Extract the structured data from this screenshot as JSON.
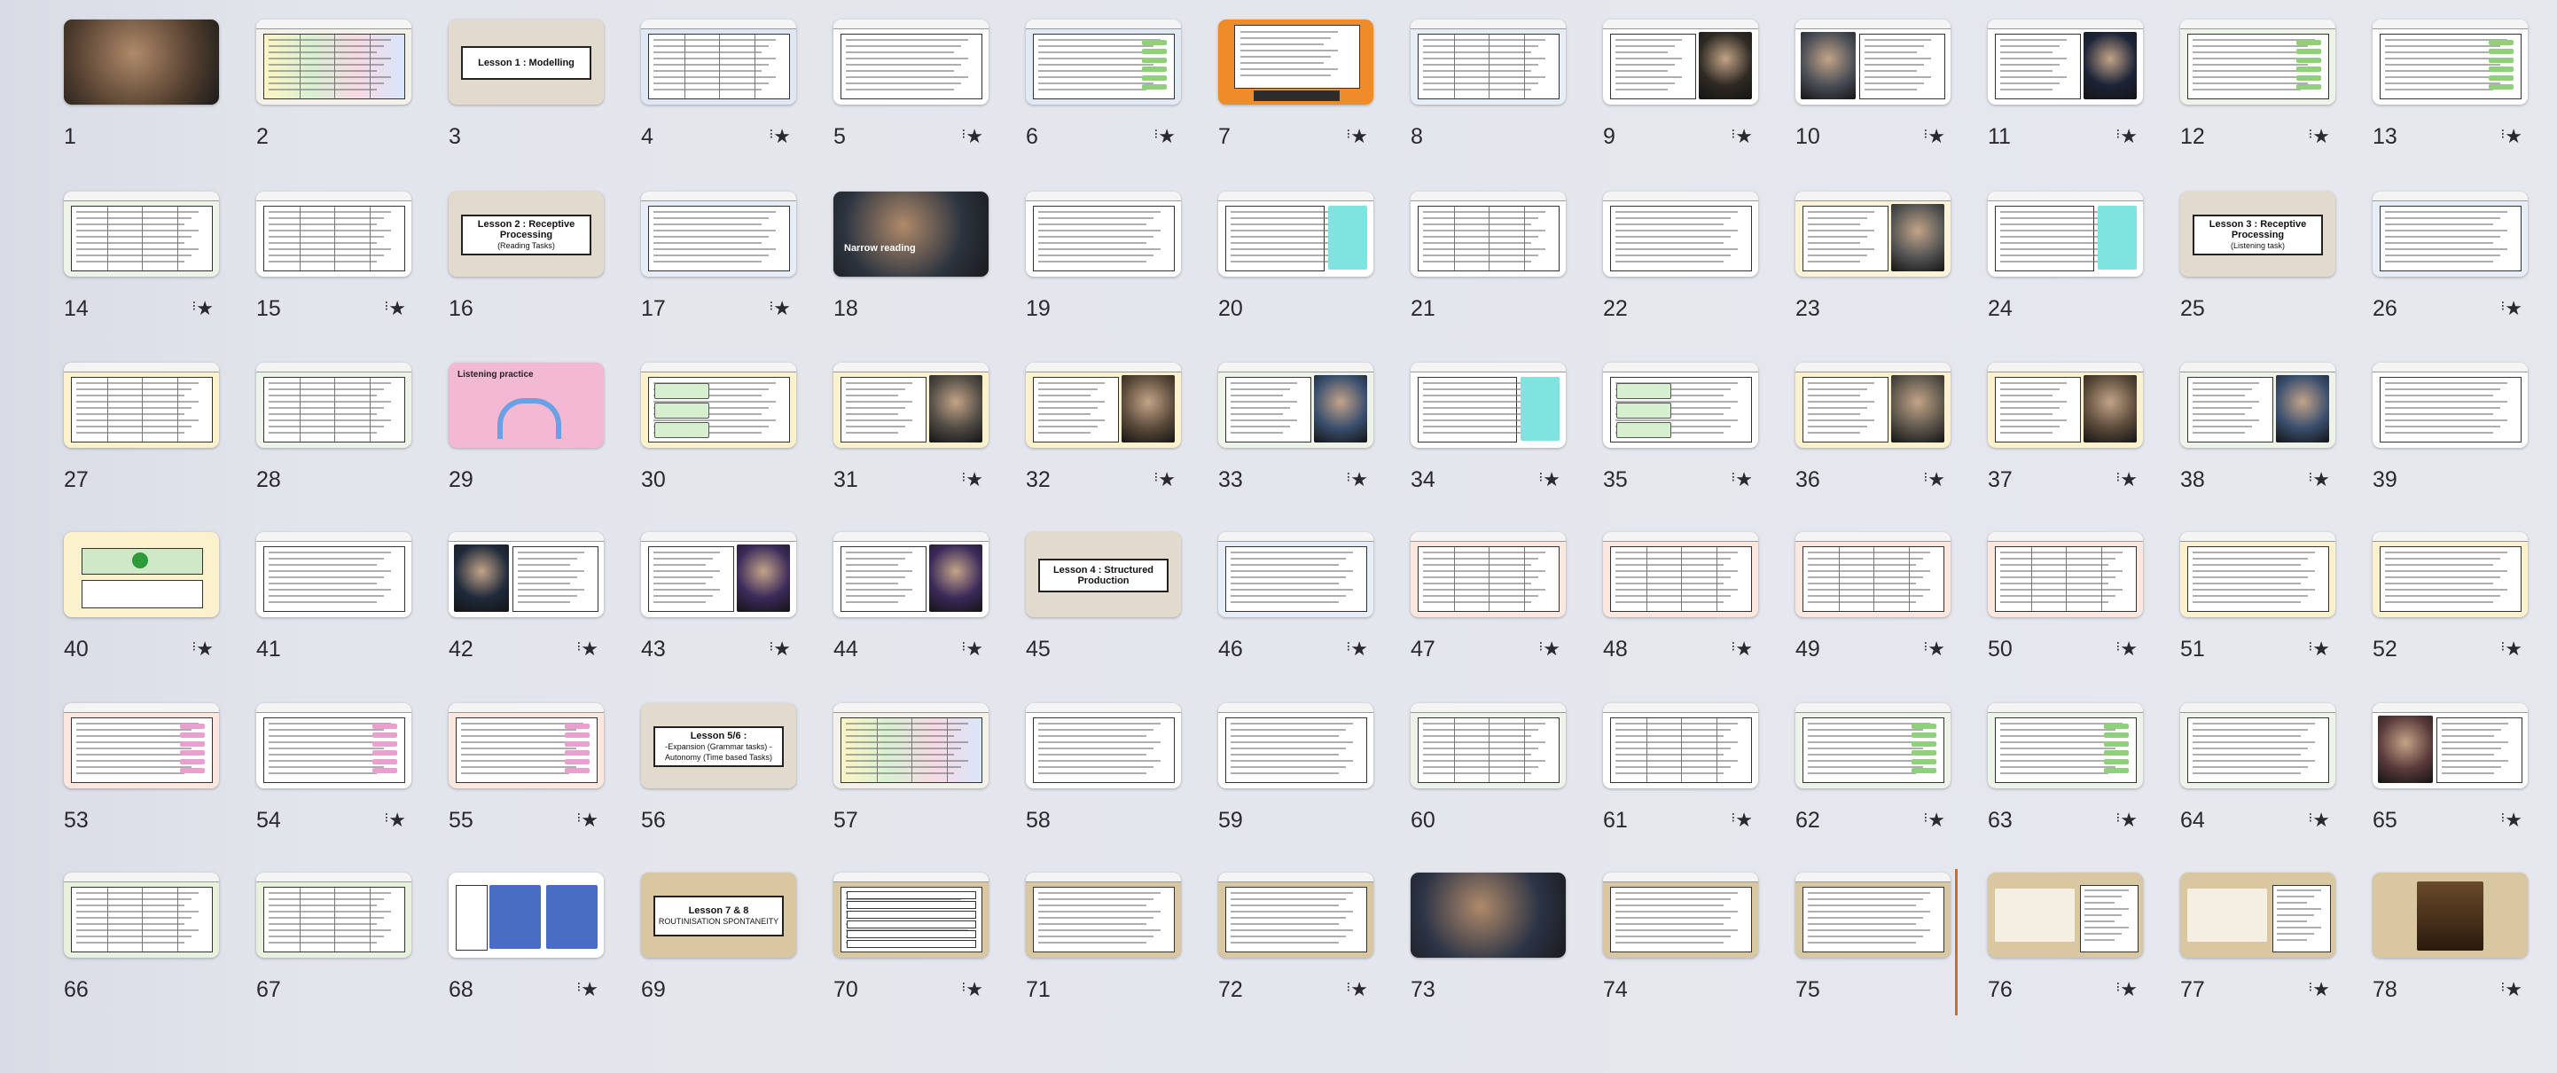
{
  "grid": {
    "slides": [
      {
        "n": "1",
        "starred": false,
        "bg": "#c8b9a6",
        "style": "photo",
        "pic": "#54402f"
      },
      {
        "n": "2",
        "starred": false,
        "bg": "#f3f1e9",
        "style": "table-color"
      },
      {
        "n": "3",
        "starred": false,
        "bg": "#e2dbcd",
        "style": "title",
        "title": "Lesson 1 : Modelling"
      },
      {
        "n": "4",
        "starred": true,
        "bg": "#dfe6f4",
        "style": "list-two"
      },
      {
        "n": "5",
        "starred": true,
        "bg": "#ffffff",
        "style": "list"
      },
      {
        "n": "6",
        "starred": true,
        "bg": "#e1e9f4",
        "style": "list-green"
      },
      {
        "n": "7",
        "starred": true,
        "bg": "#ef8c2a",
        "style": "orange"
      },
      {
        "n": "8",
        "starred": false,
        "bg": "#e6edf6",
        "style": "table"
      },
      {
        "n": "9",
        "starred": true,
        "bg": "#ffffff",
        "style": "list-pic",
        "pic": "#2e2a23"
      },
      {
        "n": "10",
        "starred": true,
        "bg": "#ffffff",
        "style": "pic-list",
        "pic": "#4b4f57"
      },
      {
        "n": "11",
        "starred": true,
        "bg": "#ffffff",
        "style": "list-pic",
        "pic": "#1c2437"
      },
      {
        "n": "12",
        "starred": true,
        "bg": "#eef3ea",
        "style": "list-green"
      },
      {
        "n": "13",
        "starred": true,
        "bg": "#ffffff",
        "style": "list-green"
      },
      {
        "n": "14",
        "starred": true,
        "bg": "#edf3e7",
        "style": "list-two"
      },
      {
        "n": "15",
        "starred": true,
        "bg": "#ffffff",
        "style": "table"
      },
      {
        "n": "16",
        "starred": false,
        "bg": "#e2dbcd",
        "style": "title",
        "title": "Lesson 2 : Receptive Processing",
        "subtitle": "(Reading Tasks)"
      },
      {
        "n": "17",
        "starred": true,
        "bg": "#e6edf6",
        "style": "list"
      },
      {
        "n": "18",
        "starred": false,
        "bg": "#4f8b5a",
        "style": "photo-label",
        "pic": "#2c3440",
        "label": "Narrow reading"
      },
      {
        "n": "19",
        "starred": false,
        "bg": "#ffffff",
        "style": "text"
      },
      {
        "n": "20",
        "starred": false,
        "bg": "#ffffff",
        "style": "text-cyan"
      },
      {
        "n": "21",
        "starred": false,
        "bg": "#ffffff",
        "style": "table"
      },
      {
        "n": "22",
        "starred": false,
        "bg": "#ffffff",
        "style": "text"
      },
      {
        "n": "23",
        "starred": false,
        "bg": "#fbf3d6",
        "style": "text-pic"
      },
      {
        "n": "24",
        "starred": false,
        "bg": "#ffffff",
        "style": "text-cyan"
      },
      {
        "n": "25",
        "starred": false,
        "bg": "#e2dbcd",
        "style": "title",
        "title": "Lesson 3 : Receptive Processing",
        "subtitle": "(Listening task)"
      },
      {
        "n": "26",
        "starred": true,
        "bg": "#e6edf6",
        "style": "list"
      },
      {
        "n": "27",
        "starred": false,
        "bg": "#fbf1cd",
        "style": "table"
      },
      {
        "n": "28",
        "starred": false,
        "bg": "#eef3ea",
        "style": "table"
      },
      {
        "n": "29",
        "starred": false,
        "bg": "#f3b9d3",
        "style": "headphones",
        "label": "Listening practice"
      },
      {
        "n": "30",
        "starred": false,
        "bg": "#fbf1cd",
        "style": "boxes"
      },
      {
        "n": "31",
        "starred": true,
        "bg": "#fbf1cd",
        "style": "list-pic",
        "pic": "#4f4a43"
      },
      {
        "n": "32",
        "starred": true,
        "bg": "#fbf1cd",
        "style": "list-pic",
        "pic": "#5a4a3a"
      },
      {
        "n": "33",
        "starred": true,
        "bg": "#eef3ea",
        "style": "list-pic",
        "pic": "#3a4e6e"
      },
      {
        "n": "34",
        "starred": true,
        "bg": "#ffffff",
        "style": "text-cyan"
      },
      {
        "n": "35",
        "starred": true,
        "bg": "#ffffff",
        "style": "boxes"
      },
      {
        "n": "36",
        "starred": true,
        "bg": "#fbf1cd",
        "style": "list-pic",
        "pic": "#5c564b"
      },
      {
        "n": "37",
        "starred": true,
        "bg": "#fbf1cd",
        "style": "list-pic",
        "pic": "#5a4a3a"
      },
      {
        "n": "38",
        "starred": true,
        "bg": "#eef3ea",
        "style": "list-pic",
        "pic": "#3a4e6e"
      },
      {
        "n": "39",
        "starred": false,
        "bg": "#ffffff",
        "style": "text"
      },
      {
        "n": "40",
        "starred": true,
        "bg": "#fbf1cd",
        "style": "audio"
      },
      {
        "n": "41",
        "starred": false,
        "bg": "#ffffff",
        "style": "text"
      },
      {
        "n": "42",
        "starred": true,
        "bg": "#ffffff",
        "style": "pic-list",
        "pic": "#1f2a3b"
      },
      {
        "n": "43",
        "starred": true,
        "bg": "#ffffff",
        "style": "list-pic",
        "pic": "#3b2a5a"
      },
      {
        "n": "44",
        "starred": true,
        "bg": "#ffffff",
        "style": "list-pic",
        "pic": "#3b2a5a"
      },
      {
        "n": "45",
        "starred": false,
        "bg": "#e2dbcd",
        "style": "title",
        "title": "Lesson 4 : Structured Production"
      },
      {
        "n": "46",
        "starred": true,
        "bg": "#e6edf6",
        "style": "list"
      },
      {
        "n": "47",
        "starred": true,
        "bg": "#fbe7de",
        "style": "table"
      },
      {
        "n": "48",
        "starred": true,
        "bg": "#fbe7de",
        "style": "table"
      },
      {
        "n": "49",
        "starred": true,
        "bg": "#fbe7de",
        "style": "table"
      },
      {
        "n": "50",
        "starred": true,
        "bg": "#fbe7de",
        "style": "table"
      },
      {
        "n": "51",
        "starred": true,
        "bg": "#fbf1cd",
        "style": "text"
      },
      {
        "n": "52",
        "starred": true,
        "bg": "#fbf1cd",
        "style": "text"
      },
      {
        "n": "53",
        "starred": false,
        "bg": "#fbe7de",
        "style": "tick"
      },
      {
        "n": "54",
        "starred": true,
        "bg": "#ffffff",
        "style": "tick"
      },
      {
        "n": "55",
        "starred": true,
        "bg": "#fbe7de",
        "style": "tick"
      },
      {
        "n": "56",
        "starred": false,
        "bg": "#e2dbcd",
        "style": "title",
        "title": "Lesson 5/6 :",
        "subtitle": "-Expansion (Grammar tasks) -Autonomy (Time based Tasks)"
      },
      {
        "n": "57",
        "starred": false,
        "bg": "#f3f1e9",
        "style": "table-color"
      },
      {
        "n": "58",
        "starred": false,
        "bg": "#ffffff",
        "style": "text"
      },
      {
        "n": "59",
        "starred": false,
        "bg": "#ffffff",
        "style": "text"
      },
      {
        "n": "60",
        "starred": false,
        "bg": "#eef3ea",
        "style": "table"
      },
      {
        "n": "61",
        "starred": true,
        "bg": "#ffffff",
        "style": "table"
      },
      {
        "n": "62",
        "starred": true,
        "bg": "#eef3ea",
        "style": "list-green"
      },
      {
        "n": "63",
        "starred": true,
        "bg": "#eef3ea",
        "style": "list-green"
      },
      {
        "n": "64",
        "starred": true,
        "bg": "#eef3ea",
        "style": "list"
      },
      {
        "n": "65",
        "starred": true,
        "bg": "#ffffff",
        "style": "pic-list",
        "pic": "#5a3a3a"
      },
      {
        "n": "66",
        "starred": false,
        "bg": "#e7f1dc",
        "style": "table"
      },
      {
        "n": "67",
        "starred": false,
        "bg": "#e7f1dc",
        "style": "table"
      },
      {
        "n": "68",
        "starred": true,
        "bg": "#ffffff",
        "style": "blue"
      },
      {
        "n": "69",
        "starred": false,
        "bg": "#d9c7a2",
        "style": "title",
        "title": "Lesson 7 & 8",
        "subtitle": "ROUTINISATION SPONTANEITY"
      },
      {
        "n": "70",
        "starred": true,
        "bg": "#d9c7a2",
        "style": "stripes"
      },
      {
        "n": "71",
        "starred": false,
        "bg": "#d9c7a2",
        "style": "text"
      },
      {
        "n": "72",
        "starred": true,
        "bg": "#d9c7a2",
        "style": "text"
      },
      {
        "n": "73",
        "starred": false,
        "bg": "#ffffff",
        "style": "comic",
        "pic": "#2b3346"
      },
      {
        "n": "74",
        "starred": false,
        "bg": "#d9c7a2",
        "style": "text"
      },
      {
        "n": "75",
        "starred": false,
        "bg": "#d9c7a2",
        "style": "text"
      },
      {
        "n": "76",
        "starred": true,
        "bg": "#d9c7a2",
        "style": "logo"
      },
      {
        "n": "77",
        "starred": true,
        "bg": "#d9c7a2",
        "style": "logo"
      },
      {
        "n": "78",
        "starred": true,
        "bg": "#d9c7a2",
        "style": "book"
      }
    ]
  },
  "star_glyph": "★",
  "insertion_marker_color": "#d8691b"
}
